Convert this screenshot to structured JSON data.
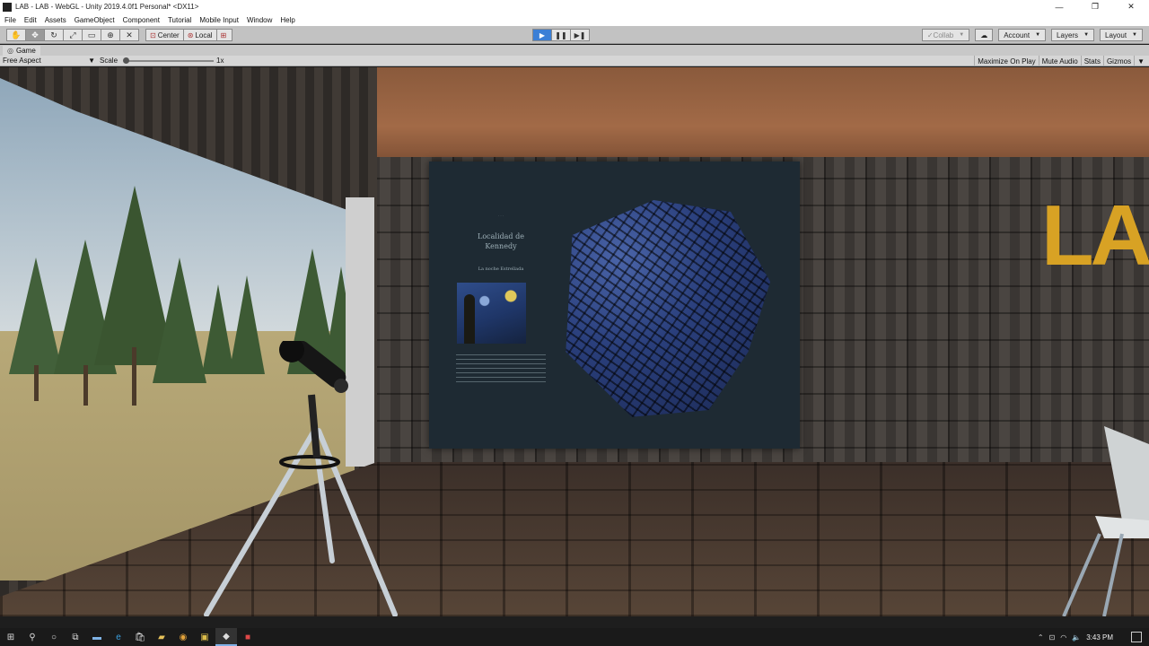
{
  "window": {
    "title": "LAB - LAB - WebGL - Unity 2019.4.0f1 Personal* <DX11>",
    "minimize": "—",
    "maximize": "❐",
    "close": "✕"
  },
  "menu": [
    "File",
    "Edit",
    "Assets",
    "GameObject",
    "Component",
    "Tutorial",
    "Mobile Input",
    "Window",
    "Help"
  ],
  "toolbar": {
    "tools": [
      "hand-icon",
      "move-icon",
      "rotate-icon",
      "scale-icon",
      "rect-icon",
      "transform-icon",
      "custom-tool-icon"
    ],
    "pivot_center": "Center",
    "pivot_local": "Local",
    "collab": "Collab",
    "account": "Account",
    "layers": "Layers",
    "layout": "Layout"
  },
  "game_tab": {
    "label": "Game",
    "aspect": "Free Aspect",
    "scale_label": "Scale",
    "scale_value": "1x",
    "scale_fraction": 0.0,
    "options": [
      "Maximize On Play",
      "Mute Audio",
      "Stats",
      "Gizmos"
    ]
  },
  "scene": {
    "poster_title_line1": "Localidad de",
    "poster_title_line2": "Kennedy",
    "poster_subtitle": "La noche Estrellada",
    "sign_text": "LA"
  },
  "taskbar": {
    "time": "3:43 PM",
    "apps": [
      "windows-icon",
      "search-icon",
      "cortana-icon",
      "task-view-icon",
      "explorer-icon",
      "edge-icon",
      "store-icon",
      "files-icon",
      "chrome-icon",
      "media-icon",
      "unity-icon",
      "app-icon"
    ]
  }
}
